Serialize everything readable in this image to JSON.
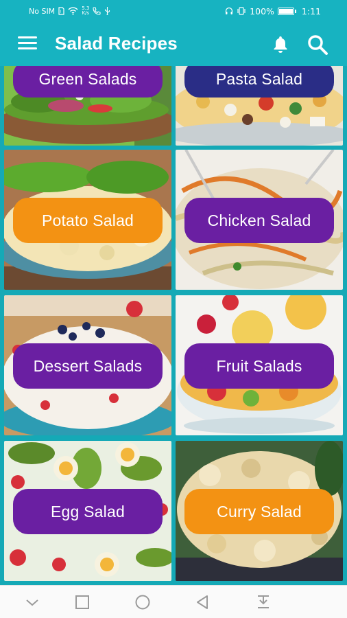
{
  "status_bar": {
    "carrier": "No SIM",
    "speed_value": "5.3",
    "speed_unit": "K/s",
    "battery_percent": "100%",
    "battery_level": 1.0,
    "time": "1:11"
  },
  "app_bar": {
    "title": "Salad Recipes"
  },
  "categories": [
    {
      "label": "Green Salads",
      "color": "#6a1fa2"
    },
    {
      "label": "Pasta Salad",
      "color": "#2a2d86"
    },
    {
      "label": "Potato Salad",
      "color": "#f39213"
    },
    {
      "label": "Chicken Salad",
      "color": "#6a1fa2"
    },
    {
      "label": "Dessert Salads",
      "color": "#6a1fa2"
    },
    {
      "label": "Fruit Salads",
      "color": "#6a1fa2"
    },
    {
      "label": "Egg Salad",
      "color": "#6a1fa2"
    },
    {
      "label": "Curry Salad",
      "color": "#f39213"
    }
  ],
  "theme": {
    "primary": "#17b3c1",
    "background": "#15a9b6",
    "nav_background": "#fafafa"
  },
  "nav_bar": {
    "icons": [
      "chevron-down-icon",
      "square-icon",
      "circle-home-icon",
      "triangle-back-icon",
      "download-icon"
    ]
  }
}
